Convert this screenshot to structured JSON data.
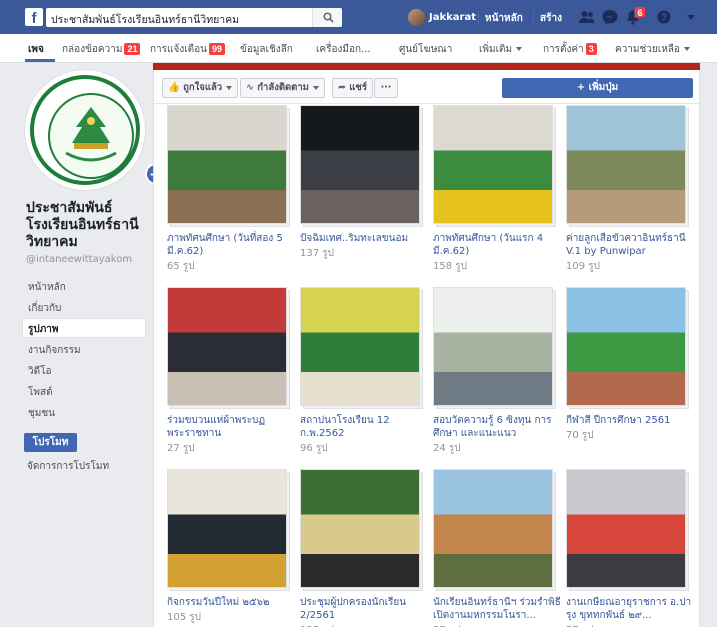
{
  "topbar": {
    "search_text": "ประชาสัมพันธ์โรงเรียนอินทร์ธานีวิทยาคม",
    "username": "Jakkarat",
    "home": "หน้าหลัก",
    "create": "สร้าง",
    "notif_count": "6"
  },
  "pagenav": {
    "items": [
      {
        "label": "เพจ"
      },
      {
        "label": "กล่องข้อความ",
        "badge": "21"
      },
      {
        "label": "การแจ้งเตือน",
        "badge": "99"
      },
      {
        "label": "ข้อมูลเชิงลึก"
      },
      {
        "label": "เครื่องมือก..."
      },
      {
        "label": "ศูนย์โฆษณา"
      },
      {
        "label": "เพิ่มเติม"
      },
      {
        "label": "การตั้งค่า",
        "badge": "3"
      },
      {
        "label": "ความช่วยเหลือ"
      }
    ]
  },
  "page": {
    "name": "ประชาสัมพันธ์ โรงเรียนอินทร์ธานี วิทยาคม",
    "handle": "@intaneewittayakom",
    "seal_text": "โรงเรียนอินทร์ธานี"
  },
  "sidebar": {
    "items": [
      "หน้าหลัก",
      "เกี่ยวกับ",
      "รูปภาพ",
      "งานกิจกรรม",
      "วิดีโอ",
      "โพสต์",
      "ชุมชน"
    ],
    "promote": "โปรโมท",
    "manage_promotions": "จัดการการโปรโมท"
  },
  "actions": {
    "liked": "ถูกใจแล้ว",
    "following": "กำลังติดตาม",
    "share": "แชร์",
    "more": "···",
    "add_button": "+ เพิ่มปุ่ม"
  },
  "albums": [
    {
      "title": "ภาพทัศนศึกษา (วันที่สอง 5 มี.ค.62)",
      "count": "65 รูป",
      "colors": [
        "#d9d6cf",
        "#3e7a3a",
        "#8a6f52"
      ]
    },
    {
      "title": "ปัจฉิมเทศ..ริมทะเลขนอม",
      "count": "137 รูป",
      "colors": [
        "#15181c",
        "#3b3f45",
        "#6a6260"
      ]
    },
    {
      "title": "ภาพทัศนศึกษา (วันแรก 4 มี.ค.62)",
      "count": "158 รูป",
      "colors": [
        "#dcd9d0",
        "#3c8b3f",
        "#e5c21e"
      ]
    },
    {
      "title": "ค่ายลูกเสือขัวควาอินทร์ธานี V.1 by Punwipar",
      "count": "109 รูป",
      "colors": [
        "#9fc4d8",
        "#7f8a5a",
        "#b59b77"
      ]
    },
    {
      "title": "ร่วมขบวนแห่ผ้าพระบฏ พระราชทาน",
      "count": "27 รูป",
      "colors": [
        "#c23a3a",
        "#2b2d36",
        "#c8bfb5"
      ]
    },
    {
      "title": "สถาปนาโรงเรียน 12 ก.พ.2562",
      "count": "96 รูป",
      "colors": [
        "#d6d350",
        "#2f7d3a",
        "#e6e1cf"
      ]
    },
    {
      "title": "สอบวัดความรู้ 6 ซิงทุน การศึกษา และแนะแนว",
      "count": "24 รูป",
      "colors": [
        "#eef0ed",
        "#a7b2a0",
        "#6e7a84"
      ]
    },
    {
      "title": "กีฬาสี ปีการศึกษา 2561",
      "count": "70 รูป",
      "colors": [
        "#8cc1e6",
        "#3b9a41",
        "#b36a4c"
      ]
    },
    {
      "title": "กิจกรรมวันปีใหม่ ๒๕๖๒",
      "count": "105 รูป",
      "colors": [
        "#e9e5da",
        "#222a33",
        "#d3a132"
      ]
    },
    {
      "title": "ประชุมผู้ปกครองนักเรียน 2/2561",
      "count": "135 รูป",
      "colors": [
        "#3c6e36",
        "#d8c98c",
        "#2b2b2b"
      ]
    },
    {
      "title": "นักเรียนอินทร์ธานีฯ ร่วมรำพิธีเปิดงานมหกรรมโนรา...",
      "count": "37 รูป",
      "colors": [
        "#9ac3e1",
        "#c2864c",
        "#5f6e3f"
      ]
    },
    {
      "title": "งานเกษียณอายุราชการ อ.ปารุง ขุททกพันธ์ ๒๙...",
      "count": "57 รูป",
      "colors": [
        "#c7c9cf",
        "#d7463b",
        "#3c3c42"
      ]
    }
  ]
}
